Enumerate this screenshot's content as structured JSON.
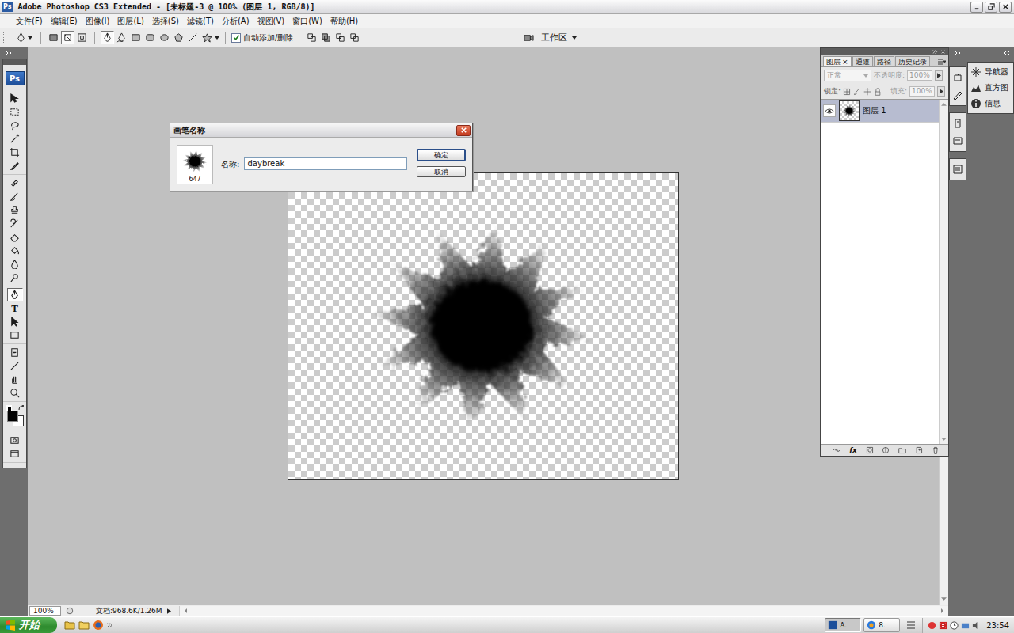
{
  "window": {
    "title": "Adobe Photoshop CS3 Extended - [未标题-3 @ 100% (图层 1, RGB/8)]",
    "app_badge": "Ps"
  },
  "menu": [
    "文件(F)",
    "编辑(E)",
    "图像(I)",
    "图层(L)",
    "选择(S)",
    "滤镜(T)",
    "分析(A)",
    "视图(V)",
    "窗口(W)",
    "帮助(H)"
  ],
  "options_bar": {
    "path_modes": [
      {
        "selected": false
      },
      {
        "selected": true
      },
      {
        "selected": false
      }
    ],
    "shape_tools": [
      {
        "selected": true
      },
      {
        "selected": false
      },
      {
        "selected": false
      },
      {
        "selected": false
      },
      {
        "selected": false
      },
      {
        "selected": false
      },
      {
        "selected": false
      },
      {
        "selected": false
      }
    ],
    "auto_add_delete": {
      "label": "自动添加/删除",
      "checked": true
    },
    "combine_modes": [
      {
        "selected": false
      },
      {
        "selected": false
      },
      {
        "selected": false
      },
      {
        "selected": false
      }
    ],
    "workspace": "工作区"
  },
  "toolbox": {
    "logo": "Ps",
    "groups": [
      [
        {
          "selected": false
        },
        {
          "selected": false
        },
        {
          "selected": false
        },
        {
          "selected": false
        },
        {
          "selected": false
        },
        {
          "selected": false
        }
      ],
      [
        {
          "selected": false
        },
        {
          "selected": false
        },
        {
          "selected": false
        },
        {
          "selected": false
        },
        {
          "selected": false
        },
        {
          "selected": false
        },
        {
          "selected": false
        },
        {
          "selected": false
        }
      ],
      [
        {
          "selected": true
        },
        {
          "selected": false,
          "glyph": "T"
        },
        {
          "selected": false
        },
        {
          "selected": false
        }
      ],
      [
        {
          "selected": false
        },
        {
          "selected": false
        },
        {
          "selected": false
        },
        {
          "selected": false
        }
      ],
      [
        {
          "selected": false
        },
        {
          "selected": false
        }
      ]
    ]
  },
  "dialog": {
    "title": "画笔名称",
    "brush_size": "647",
    "name_label": "名称:",
    "name_value": "daybreak",
    "buttons": [
      {
        "label": "确定",
        "default": true
      },
      {
        "label": "取消",
        "default": false
      }
    ]
  },
  "layers_panel": {
    "tabs": [
      {
        "label": "图层",
        "selected": true,
        "close": "×"
      },
      {
        "label": "通道",
        "selected": false
      },
      {
        "label": "路径",
        "selected": false
      },
      {
        "label": "历史记录",
        "selected": false
      }
    ],
    "blend_mode": {
      "value": "正常",
      "disabled": true
    },
    "opacity": {
      "label": "不透明度:",
      "value": "100%",
      "disabled": true
    },
    "lock_label": "锁定:",
    "fill": {
      "label": "填充:",
      "value": "100%",
      "disabled": true
    },
    "layers": [
      {
        "name": "图层 1",
        "visible": true,
        "selected": true
      }
    ],
    "footer_fx": "fx"
  },
  "dock": {
    "items": [
      {
        "label": "导航器"
      },
      {
        "label": "直方图"
      },
      {
        "label": "信息"
      }
    ]
  },
  "status_bar": {
    "zoom": "100%",
    "doc_info": "文档:968.6K/1.26M"
  },
  "taskbar": {
    "start": "开始",
    "tasks": [
      {
        "label": "A.",
        "selected": true
      },
      {
        "label": "8.",
        "selected": false
      }
    ],
    "clock": "23:54"
  }
}
